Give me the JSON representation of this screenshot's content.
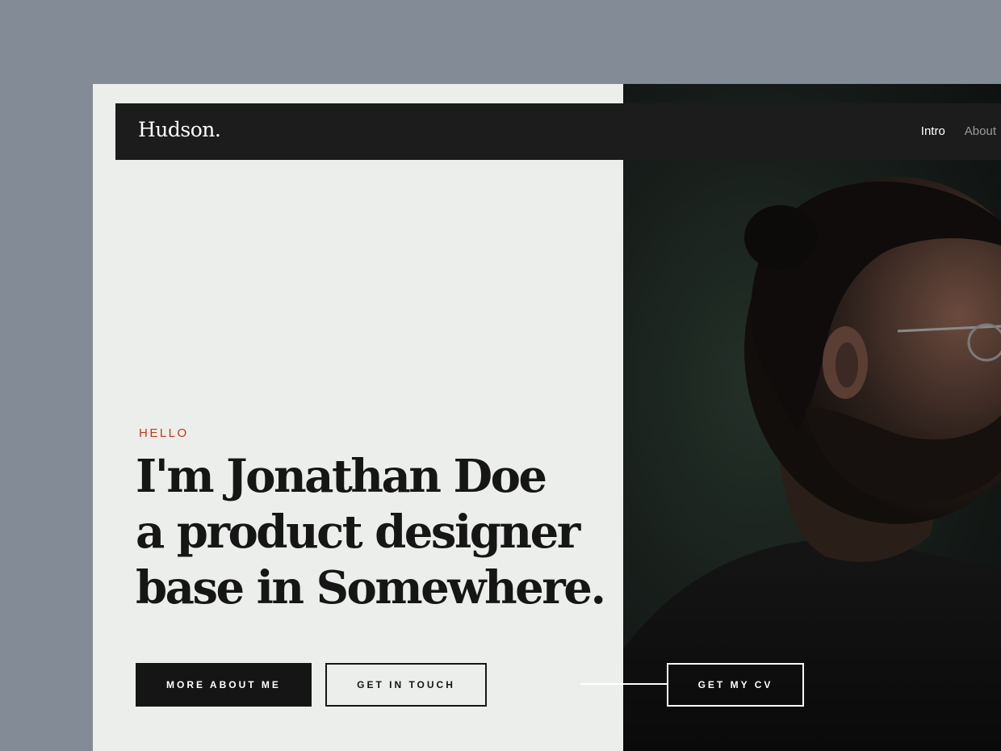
{
  "header": {
    "logo": "Hudson.",
    "nav": [
      {
        "label": "Intro",
        "active": true
      },
      {
        "label": "About",
        "active": false
      }
    ]
  },
  "hero": {
    "eyebrow": "HELLO",
    "headline_lines": [
      "I'm Jonathan Doe",
      "a product designer",
      "base in Somewhere."
    ],
    "buttons": {
      "primary": "MORE ABOUT ME",
      "secondary": "GET IN TOUCH",
      "cv": "GET MY CV"
    }
  },
  "colors": {
    "page_bg": "#828b96",
    "panel_bg": "#eceeeb",
    "header_bg": "#1c1c1c",
    "accent": "#c0391b",
    "text_dark": "#161616"
  },
  "icons": {
    "portrait": "portrait-photo"
  }
}
